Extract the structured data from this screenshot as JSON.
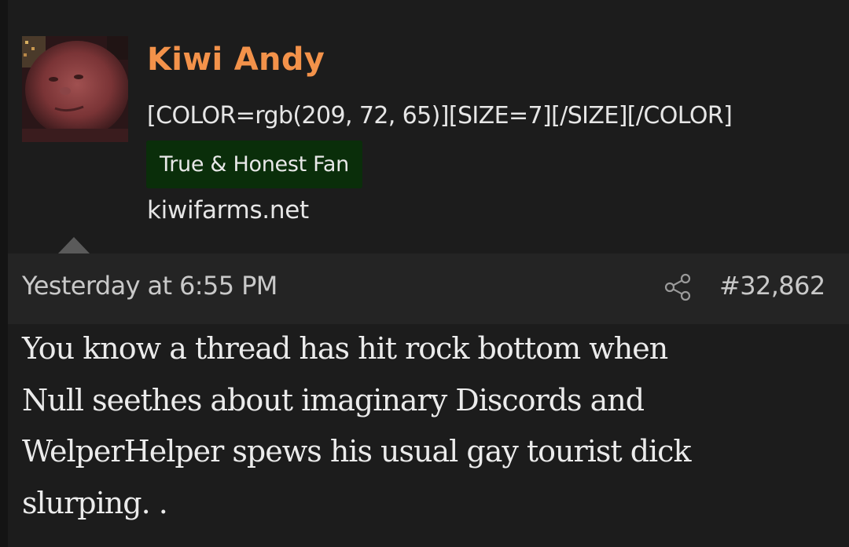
{
  "user": {
    "avatar": "avatar",
    "name": "Kiwi Andy",
    "title": "[COLOR=rgb(209, 72, 65)][SIZE=7][/SIZE][/COLOR]",
    "banner": "True & Honest Fan",
    "site": "kiwifarms.net"
  },
  "post": {
    "timestamp": "Yesterday at 6:55 PM",
    "share_icon": "share-icon",
    "number": "#32,862",
    "lines": [
      "You know a thread has hit rock bottom when",
      "Null seethes about imaginary Discords and",
      "WelperHelper spews his usual gay tourist dick",
      "slurping. ."
    ]
  },
  "colors": {
    "username": "#f3924a",
    "banner_bg": "#0a2e0a",
    "background": "#1c1c1c",
    "meta_bar": "#242424"
  }
}
